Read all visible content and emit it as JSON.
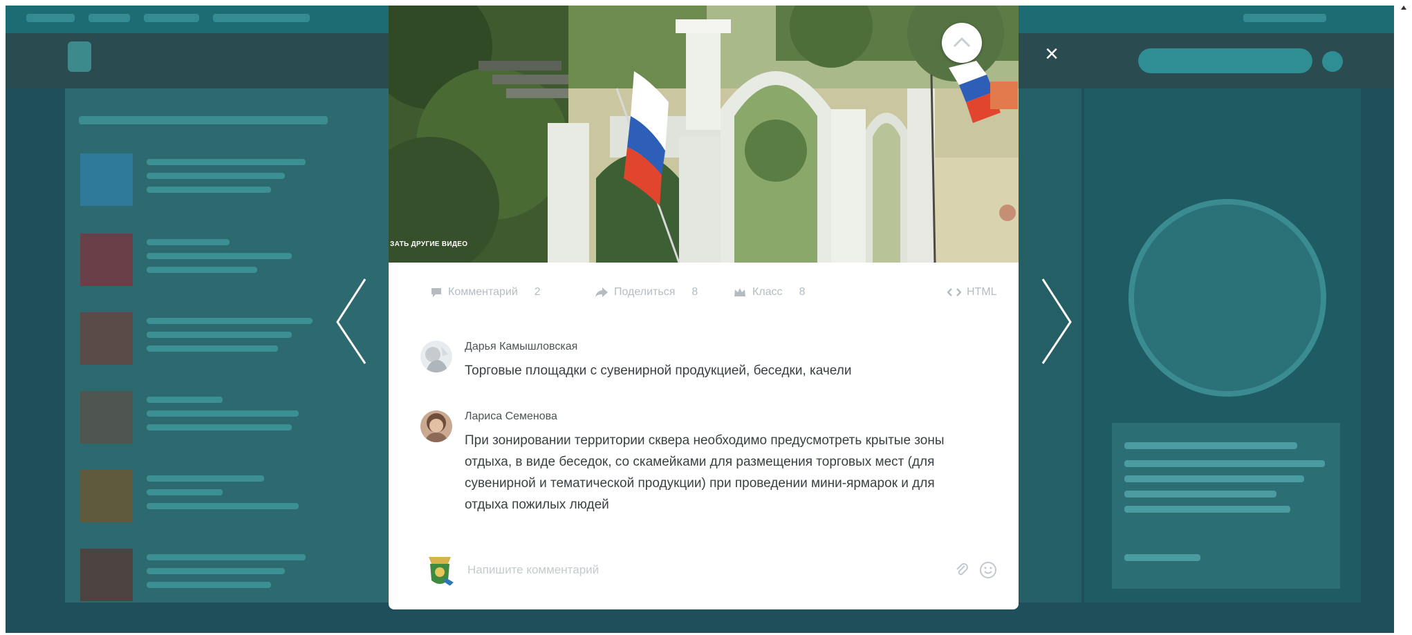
{
  "modal": {
    "close_glyph": "×",
    "video": {
      "caption": "ЗАТЬ ДРУГИЕ ВИДЕО"
    },
    "actions": [
      {
        "icon": "comment-bubble-icon",
        "label": "Комментарий",
        "count": "2"
      },
      {
        "icon": "share-arrow-icon",
        "label": "Поделиться",
        "count": "8"
      },
      {
        "icon": "crown-icon",
        "label": "Класс",
        "count": "8"
      },
      {
        "icon": "embed-code-icon",
        "label": "HTML",
        "count": ""
      }
    ],
    "comments": [
      {
        "author": "Дарья Камышловская",
        "text": "Торговые площадки с сувенирной продукцией, беседки, качели"
      },
      {
        "author": "Лариса Семенова",
        "text": "При зонировании территории сквера  необходимо предусмотреть крытые зоны отдыха,  в виде беседок, со скамейками для размещения торговых мест (для сувенирной и тематической продукции) при проведении мини-ярмарок и для отдыха пожилых людей"
      }
    ],
    "comment_input": {
      "placeholder": "Напишите комментарий"
    }
  },
  "colors": {
    "overlay": "#1e4f5a",
    "modal_bg": "#ffffff",
    "text": "#3b4044",
    "muted": "#b4bcc2"
  }
}
